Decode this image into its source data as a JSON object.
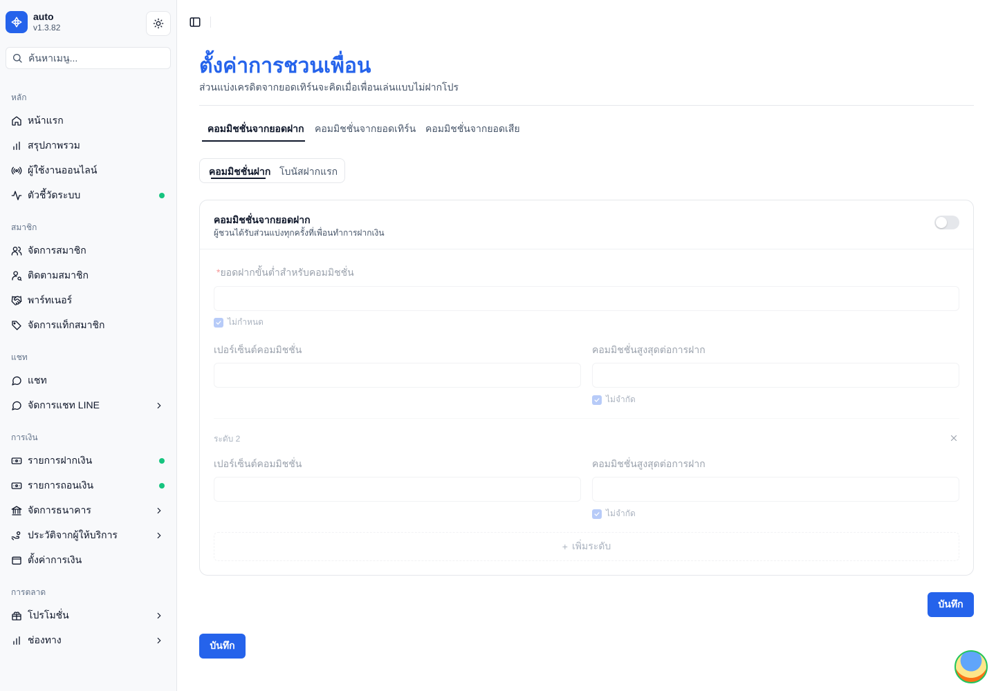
{
  "app": {
    "name": "auto",
    "version": "v1.3.82"
  },
  "search": {
    "placeholder": "ค้นหาเมนู..."
  },
  "sidebar": {
    "groups": [
      {
        "label": "หลัก",
        "items": [
          {
            "label": "หน้าแรก",
            "icon": "home-icon"
          },
          {
            "label": "สรุปภาพรวม",
            "icon": "bar-chart-icon"
          },
          {
            "label": "ผู้ใช้งานออนไลน์",
            "icon": "radio-icon"
          },
          {
            "label": "ตัวชี้วัดระบบ",
            "icon": "activity-icon",
            "dot": true
          }
        ]
      },
      {
        "label": "สมาชิก",
        "items": [
          {
            "label": "จัดการสมาชิก",
            "icon": "users-icon"
          },
          {
            "label": "ติดตามสมาชิก",
            "icon": "user-search-icon"
          },
          {
            "label": "พาร์ทเนอร์",
            "icon": "handshake-icon"
          },
          {
            "label": "จัดการแท็กสมาชิก",
            "icon": "tag-icon"
          }
        ]
      },
      {
        "label": "แชท",
        "items": [
          {
            "label": "แชท",
            "icon": "message-circle-icon"
          },
          {
            "label": "จัดการแชท LINE",
            "icon": "message-circle-icon",
            "chevron": true
          }
        ]
      },
      {
        "label": "การเงิน",
        "items": [
          {
            "label": "รายการฝากเงิน",
            "icon": "deposit-icon",
            "dot": true
          },
          {
            "label": "รายการถอนเงิน",
            "icon": "withdraw-icon",
            "dot": true
          },
          {
            "label": "จัดการธนาคาร",
            "icon": "bank-icon",
            "chevron": true
          },
          {
            "label": "ประวัติจากผู้ให้บริการ",
            "icon": "hand-coins-icon",
            "chevron": true
          },
          {
            "label": "ตั้งค่าการเงิน",
            "icon": "wallet-icon"
          }
        ]
      },
      {
        "label": "การตลาด",
        "items": [
          {
            "label": "โปรโมชั่น",
            "icon": "gift-icon",
            "chevron": true
          },
          {
            "label": "ช่องทาง",
            "icon": "bar-chart-icon",
            "chevron": true
          }
        ]
      }
    ]
  },
  "page": {
    "title": "ตั้งค่าการชวนเพื่อน",
    "subtitle": "ส่วนแบ่งเครดิตจากยอดเทิร์นจะคิดเมื่อเพื่อนเล่นแบบไม่ฝากโปร",
    "tabs": [
      "คอมมิชชั่นจากยอดฝาก",
      "คอมมิชชั่นจากยอดเทิร์น",
      "คอมมิชชั่นจากยอดเสีย"
    ],
    "active_tab": 0,
    "subtabs": [
      "คอมมิชชั่นฝาก",
      "โบนัสฝากแรก"
    ],
    "active_subtab": 0
  },
  "card": {
    "title": "คอมมิชชั่นจากยอดฝาก",
    "description": "ผู้ชวนได้รับส่วนแบ่งทุกครั้งที่เพื่อนทำการฝากเงิน",
    "enabled": false,
    "min_deposit_label": "ยอดฝากขั้นต่ำสำหรับคอมมิชชั่น",
    "required_mark": "*",
    "min_deposit_unset_label": "ไม่กำหนด",
    "percent_label": "เปอร์เซ็นต์คอมมิชชั่น",
    "max_label": "คอมมิชชั่นสูงสุดต่อการฝาก",
    "unlimited_label": "ไม่จำกัด",
    "level2_label": "ระดับ 2",
    "add_level_label": "เพิ่มระดับ",
    "add_level_plus": "+"
  },
  "buttons": {
    "save_inner": "บันทึก",
    "save_outer": "บันทึก"
  },
  "colors": {
    "accent": "#2563eb",
    "status_dot": "#16c47f"
  }
}
